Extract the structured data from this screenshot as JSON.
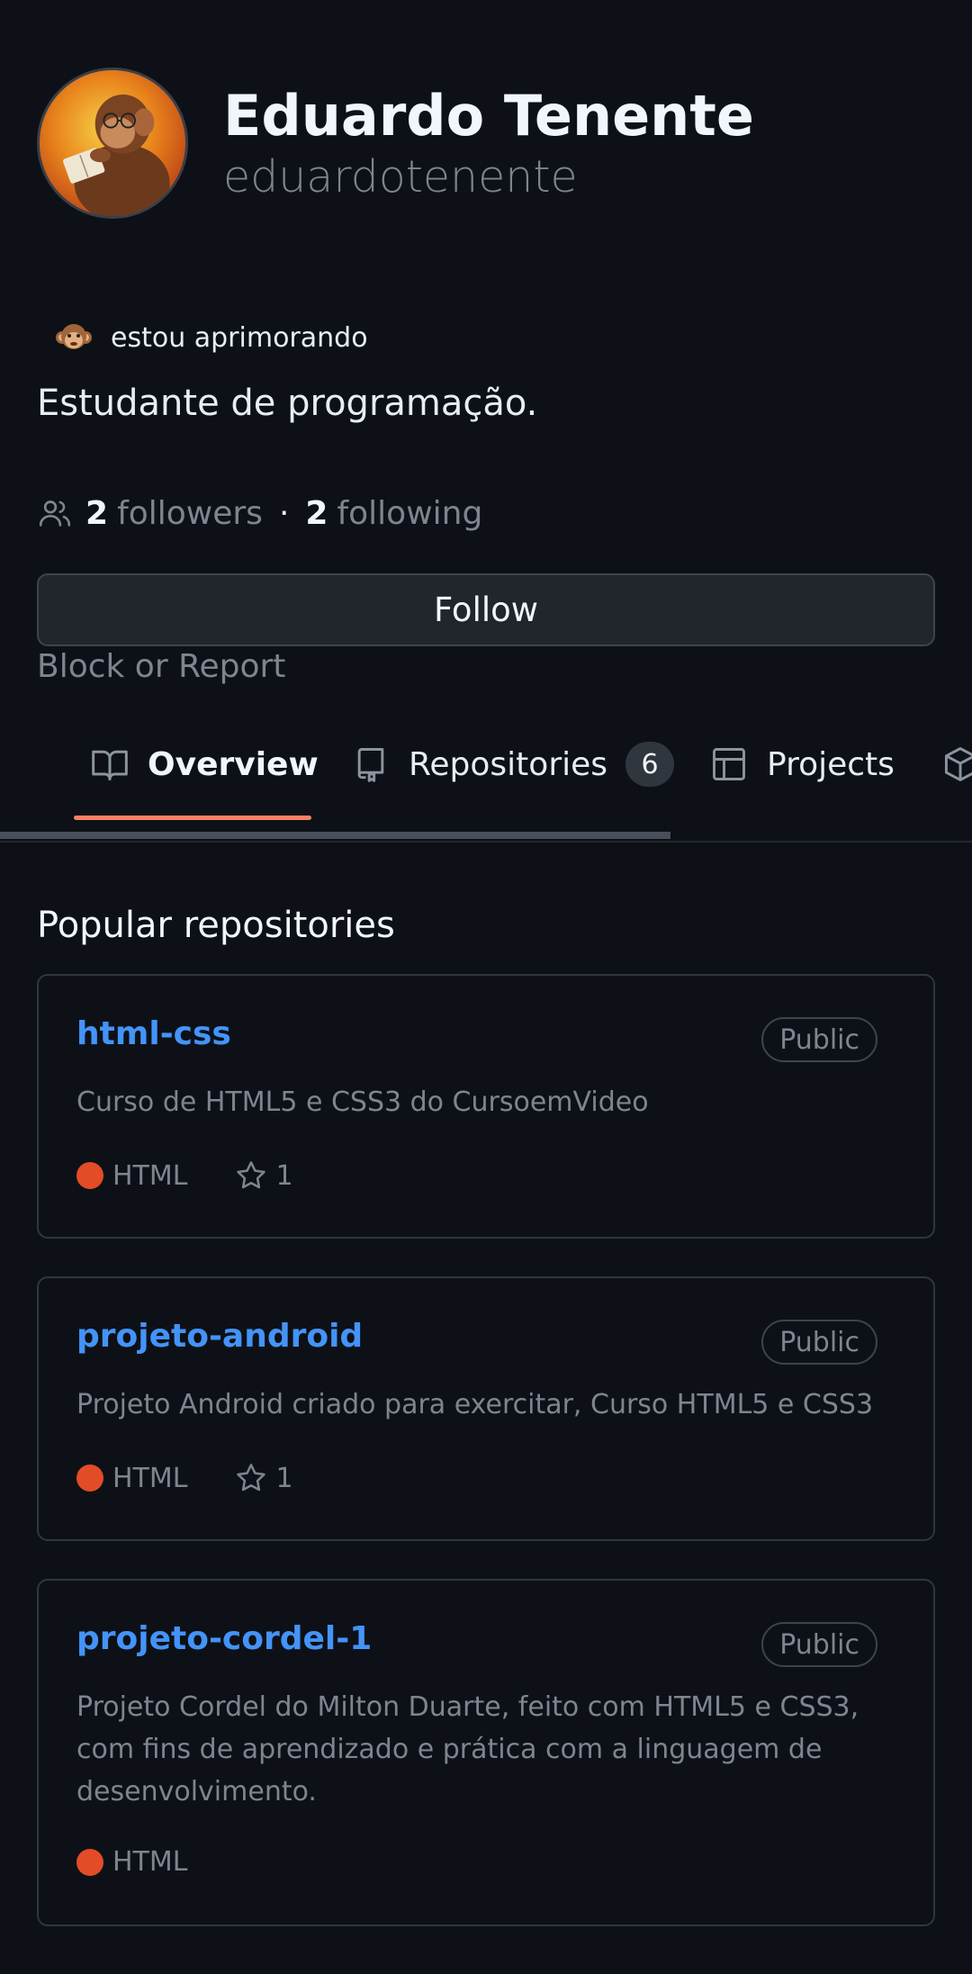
{
  "profile": {
    "display_name": "Eduardo Tenente",
    "username": "eduardotenente",
    "avatar_icon": "monkey-reading-avatar",
    "status_emoji": "monkey-face",
    "status_text": "estou aprimorando",
    "bio": "Estudante de programação.",
    "followers_count": "2",
    "followers_label": "followers",
    "separator": "·",
    "following_count": "2",
    "following_label": "following"
  },
  "actions": {
    "follow_label": "Follow",
    "block_report_label": "Block or Report"
  },
  "tabs": [
    {
      "label": "Overview",
      "icon": "book-icon",
      "active": true
    },
    {
      "label": "Repositories",
      "icon": "repo-icon",
      "count": "6"
    },
    {
      "label": "Projects",
      "icon": "table-icon"
    },
    {
      "label": "",
      "icon": "package-icon"
    }
  ],
  "popular": {
    "title": "Popular repositories",
    "repos": [
      {
        "name": "html-css",
        "visibility": "Public",
        "description": "Curso de HTML5 e CSS3 do CursoemVideo",
        "language": "HTML",
        "stars": "1"
      },
      {
        "name": "projeto-android",
        "visibility": "Public",
        "description": "Projeto Android criado para exercitar, Curso HTML5 e CSS3",
        "language": "HTML",
        "stars": "1"
      },
      {
        "name": "projeto-cordel-1",
        "visibility": "Public",
        "description": "Projeto Cordel do Milton Duarte, feito com HTML5 e CSS3, com fins de aprendizado e prática com a linguagem de desenvolvimento.",
        "language": "HTML"
      }
    ]
  },
  "colors": {
    "background": "#0d1117",
    "link": "#4493f8",
    "html_language": "#e34c26",
    "tab_underline": "#f78166"
  }
}
